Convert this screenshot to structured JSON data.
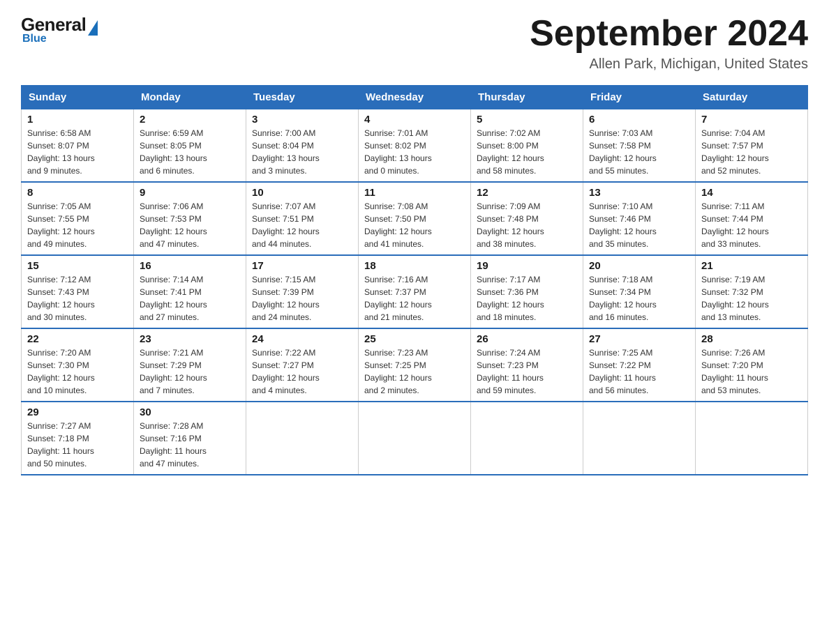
{
  "header": {
    "logo_general": "General",
    "logo_blue": "Blue",
    "month_year": "September 2024",
    "location": "Allen Park, Michigan, United States"
  },
  "weekdays": [
    "Sunday",
    "Monday",
    "Tuesday",
    "Wednesday",
    "Thursday",
    "Friday",
    "Saturday"
  ],
  "weeks": [
    [
      {
        "day": "1",
        "sunrise": "6:58 AM",
        "sunset": "8:07 PM",
        "daylight": "13 hours and 9 minutes."
      },
      {
        "day": "2",
        "sunrise": "6:59 AM",
        "sunset": "8:05 PM",
        "daylight": "13 hours and 6 minutes."
      },
      {
        "day": "3",
        "sunrise": "7:00 AM",
        "sunset": "8:04 PM",
        "daylight": "13 hours and 3 minutes."
      },
      {
        "day": "4",
        "sunrise": "7:01 AM",
        "sunset": "8:02 PM",
        "daylight": "13 hours and 0 minutes."
      },
      {
        "day": "5",
        "sunrise": "7:02 AM",
        "sunset": "8:00 PM",
        "daylight": "12 hours and 58 minutes."
      },
      {
        "day": "6",
        "sunrise": "7:03 AM",
        "sunset": "7:58 PM",
        "daylight": "12 hours and 55 minutes."
      },
      {
        "day": "7",
        "sunrise": "7:04 AM",
        "sunset": "7:57 PM",
        "daylight": "12 hours and 52 minutes."
      }
    ],
    [
      {
        "day": "8",
        "sunrise": "7:05 AM",
        "sunset": "7:55 PM",
        "daylight": "12 hours and 49 minutes."
      },
      {
        "day": "9",
        "sunrise": "7:06 AM",
        "sunset": "7:53 PM",
        "daylight": "12 hours and 47 minutes."
      },
      {
        "day": "10",
        "sunrise": "7:07 AM",
        "sunset": "7:51 PM",
        "daylight": "12 hours and 44 minutes."
      },
      {
        "day": "11",
        "sunrise": "7:08 AM",
        "sunset": "7:50 PM",
        "daylight": "12 hours and 41 minutes."
      },
      {
        "day": "12",
        "sunrise": "7:09 AM",
        "sunset": "7:48 PM",
        "daylight": "12 hours and 38 minutes."
      },
      {
        "day": "13",
        "sunrise": "7:10 AM",
        "sunset": "7:46 PM",
        "daylight": "12 hours and 35 minutes."
      },
      {
        "day": "14",
        "sunrise": "7:11 AM",
        "sunset": "7:44 PM",
        "daylight": "12 hours and 33 minutes."
      }
    ],
    [
      {
        "day": "15",
        "sunrise": "7:12 AM",
        "sunset": "7:43 PM",
        "daylight": "12 hours and 30 minutes."
      },
      {
        "day": "16",
        "sunrise": "7:14 AM",
        "sunset": "7:41 PM",
        "daylight": "12 hours and 27 minutes."
      },
      {
        "day": "17",
        "sunrise": "7:15 AM",
        "sunset": "7:39 PM",
        "daylight": "12 hours and 24 minutes."
      },
      {
        "day": "18",
        "sunrise": "7:16 AM",
        "sunset": "7:37 PM",
        "daylight": "12 hours and 21 minutes."
      },
      {
        "day": "19",
        "sunrise": "7:17 AM",
        "sunset": "7:36 PM",
        "daylight": "12 hours and 18 minutes."
      },
      {
        "day": "20",
        "sunrise": "7:18 AM",
        "sunset": "7:34 PM",
        "daylight": "12 hours and 16 minutes."
      },
      {
        "day": "21",
        "sunrise": "7:19 AM",
        "sunset": "7:32 PM",
        "daylight": "12 hours and 13 minutes."
      }
    ],
    [
      {
        "day": "22",
        "sunrise": "7:20 AM",
        "sunset": "7:30 PM",
        "daylight": "12 hours and 10 minutes."
      },
      {
        "day": "23",
        "sunrise": "7:21 AM",
        "sunset": "7:29 PM",
        "daylight": "12 hours and 7 minutes."
      },
      {
        "day": "24",
        "sunrise": "7:22 AM",
        "sunset": "7:27 PM",
        "daylight": "12 hours and 4 minutes."
      },
      {
        "day": "25",
        "sunrise": "7:23 AM",
        "sunset": "7:25 PM",
        "daylight": "12 hours and 2 minutes."
      },
      {
        "day": "26",
        "sunrise": "7:24 AM",
        "sunset": "7:23 PM",
        "daylight": "11 hours and 59 minutes."
      },
      {
        "day": "27",
        "sunrise": "7:25 AM",
        "sunset": "7:22 PM",
        "daylight": "11 hours and 56 minutes."
      },
      {
        "day": "28",
        "sunrise": "7:26 AM",
        "sunset": "7:20 PM",
        "daylight": "11 hours and 53 minutes."
      }
    ],
    [
      {
        "day": "29",
        "sunrise": "7:27 AM",
        "sunset": "7:18 PM",
        "daylight": "11 hours and 50 minutes."
      },
      {
        "day": "30",
        "sunrise": "7:28 AM",
        "sunset": "7:16 PM",
        "daylight": "11 hours and 47 minutes."
      },
      null,
      null,
      null,
      null,
      null
    ]
  ],
  "labels": {
    "sunrise": "Sunrise:",
    "sunset": "Sunset:",
    "daylight": "Daylight:"
  }
}
